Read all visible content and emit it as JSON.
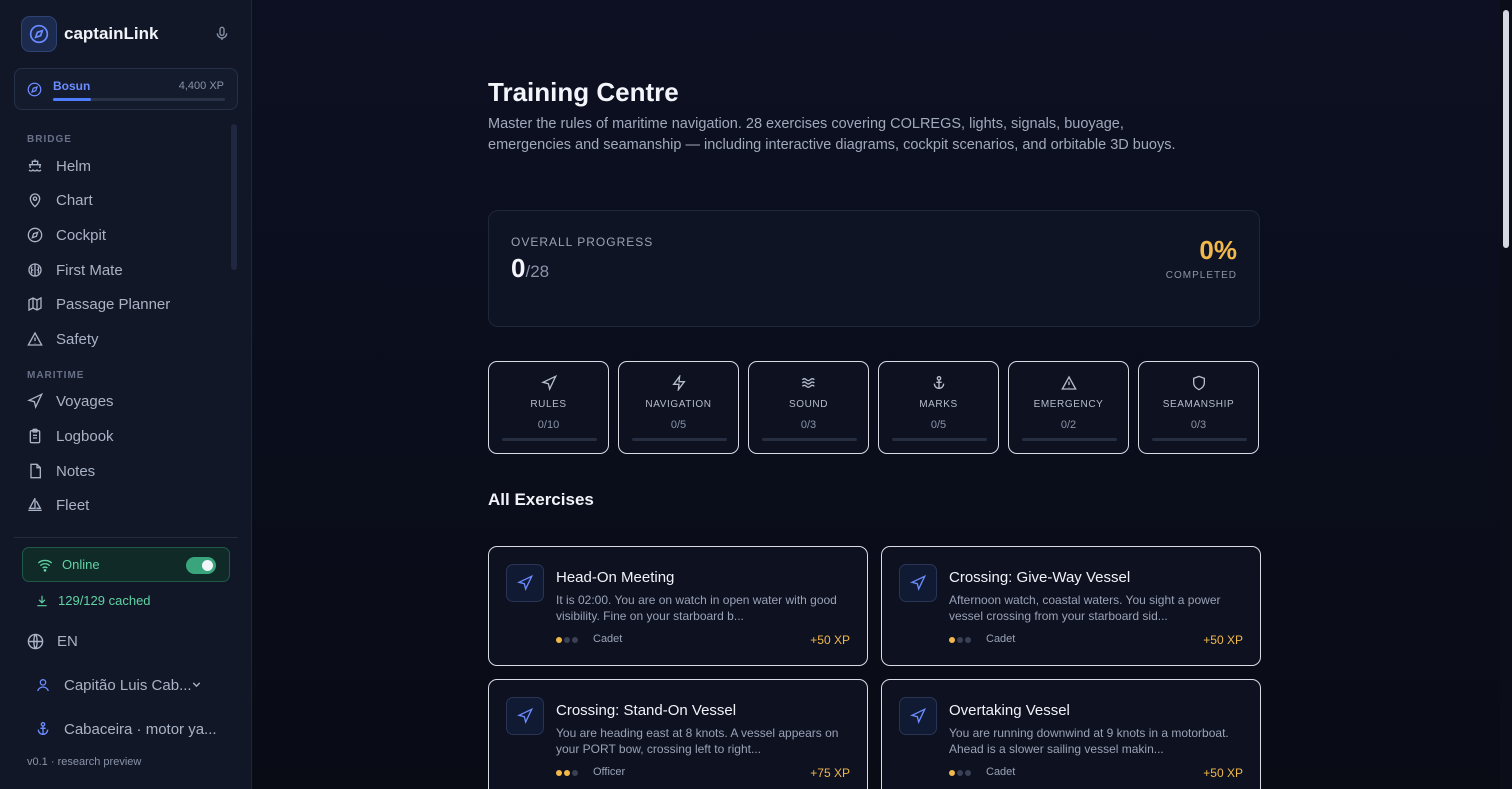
{
  "brand": {
    "name": "captainLink"
  },
  "rank": {
    "name": "Bosun",
    "xp": "4,400 XP",
    "progress": 0.22
  },
  "nav": {
    "bridge_label": "BRIDGE",
    "bridge": [
      {
        "label": "Helm",
        "icon": "ship-icon"
      },
      {
        "label": "Chart",
        "icon": "map-pin-icon"
      },
      {
        "label": "Cockpit",
        "icon": "compass-icon"
      },
      {
        "label": "First Mate",
        "icon": "brain-icon"
      },
      {
        "label": "Passage Planner",
        "icon": "map-icon"
      },
      {
        "label": "Safety",
        "icon": "warning-icon"
      }
    ],
    "maritime_label": "MARITIME",
    "maritime": [
      {
        "label": "Voyages",
        "icon": "navigation-icon"
      },
      {
        "label": "Logbook",
        "icon": "clipboard-icon"
      },
      {
        "label": "Notes",
        "icon": "note-icon"
      },
      {
        "label": "Fleet",
        "icon": "sailboat-icon"
      }
    ]
  },
  "status": {
    "online_label": "Online",
    "cached_label": "129/129 cached"
  },
  "language": "EN",
  "user": {
    "name": "Capitão Luis Cab...",
    "vessel": "Cabaceira · motor ya..."
  },
  "version": "v0.1 · research preview",
  "page": {
    "title": "Training Centre",
    "description": "Master the rules of maritime navigation. 28 exercises covering COLREGS, lights, signals, buoyage, emergencies and seamanship — including interactive diagrams, cockpit scenarios, and orbitable 3D buoys."
  },
  "progress": {
    "label": "OVERALL PROGRESS",
    "done": "0",
    "total": "/28",
    "percent": "0%",
    "completed_label": "COMPLETED"
  },
  "categories": [
    {
      "name": "RULES",
      "count": "0/10",
      "icon": "navigation-icon"
    },
    {
      "name": "NAVIGATION",
      "count": "0/5",
      "icon": "zap-icon"
    },
    {
      "name": "SOUND",
      "count": "0/3",
      "icon": "waves-icon"
    },
    {
      "name": "MARKS",
      "count": "0/5",
      "icon": "anchor-icon"
    },
    {
      "name": "EMERGENCY",
      "count": "0/2",
      "icon": "warning-icon"
    },
    {
      "name": "SEAMANSHIP",
      "count": "0/3",
      "icon": "shield-icon"
    }
  ],
  "exercises_title": "All Exercises",
  "exercises": [
    {
      "title": "Head-On Meeting",
      "desc": "It is 02:00. You are on watch in open water with good visibility. Fine on your starboard b...",
      "level": "Cadet",
      "difficulty": 1,
      "xp": "+50 XP"
    },
    {
      "title": "Crossing: Give-Way Vessel",
      "desc": "Afternoon watch, coastal waters. You sight a power vessel crossing from your starboard sid...",
      "level": "Cadet",
      "difficulty": 1,
      "xp": "+50 XP"
    },
    {
      "title": "Crossing: Stand-On Vessel",
      "desc": "You are heading east at 8 knots. A vessel appears on your PORT bow, crossing left to right...",
      "level": "Officer",
      "difficulty": 2,
      "xp": "+75 XP"
    },
    {
      "title": "Overtaking Vessel",
      "desc": "You are running downwind at 9 knots in a motorboat. Ahead is a slower sailing vessel makin...",
      "level": "Cadet",
      "difficulty": 1,
      "xp": "+50 XP"
    }
  ],
  "colors": {
    "accent": "#4f7dff",
    "gold": "#f2b84b",
    "green": "#5fd3a3"
  }
}
